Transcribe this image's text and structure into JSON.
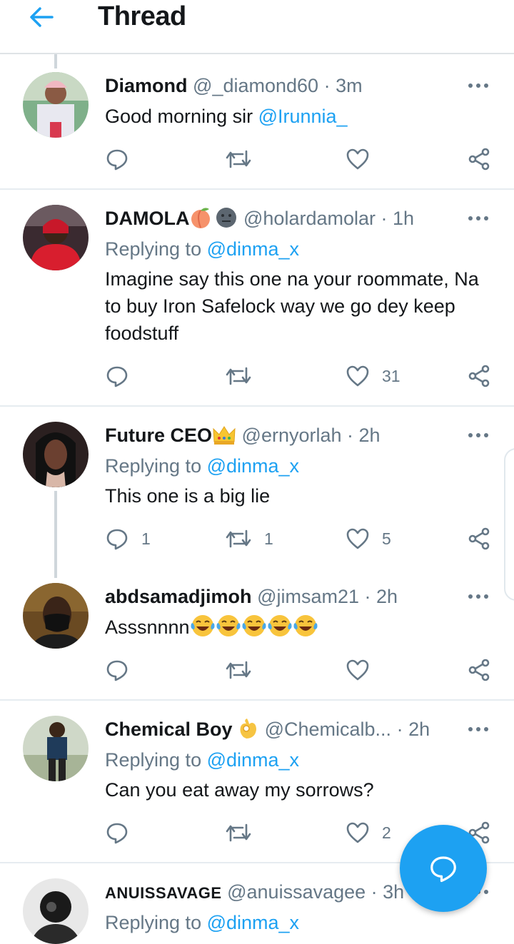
{
  "header": {
    "title": "Thread"
  },
  "tweets": [
    {
      "name": "Diamond",
      "handle": "@_diamond60",
      "time": "· 3m",
      "text_prefix": "Good morning sir ",
      "mention": "@Irunnia_",
      "reply_count": "",
      "retweet_count": "",
      "like_count": ""
    },
    {
      "name": "DAMOLA",
      "handle": "@holardamolar",
      "time": "· 1h",
      "replying_label": "Replying to ",
      "replying_to": "@dinma_x",
      "text": "Imagine say this one na your roommate, Na to buy Iron Safelock way we go dey keep foodstuff",
      "reply_count": "",
      "retweet_count": "",
      "like_count": "31"
    },
    {
      "name": "Future CEO",
      "handle": "@ernyorlah",
      "time": "· 2h",
      "replying_label": "Replying to ",
      "replying_to": "@dinma_x",
      "text": "This one is a big lie",
      "reply_count": "1",
      "retweet_count": "1",
      "like_count": "5"
    },
    {
      "name": "abdsamadjimoh",
      "handle": "@jimsam21",
      "time": "· 2h",
      "text": "Asssnnnn",
      "reply_count": "",
      "retweet_count": "",
      "like_count": ""
    },
    {
      "name": "Chemical Boy",
      "handle": "@Chemicalb...",
      "time": "· 2h",
      "replying_label": "Replying to ",
      "replying_to": "@dinma_x",
      "text": "Can you eat away my sorrows?",
      "reply_count": "",
      "retweet_count": "",
      "like_count": "2"
    },
    {
      "name": "ANUISSAVAGE",
      "handle": "@anuissavagee",
      "time": "· 3h",
      "replying_label": "Replying to ",
      "replying_to": "@dinma_x"
    }
  ],
  "icons": {
    "back": "arrow-left-icon",
    "more": "more-dots-icon",
    "reply": "reply-bubble-icon",
    "retweet": "retweet-icon",
    "like": "heart-icon",
    "share": "share-icon",
    "compose": "compose-reply-icon",
    "emoji_peach": "peach-emoji",
    "emoji_neutral": "neutral-face-emoji",
    "emoji_crown": "crown-emoji",
    "emoji_laugh": "tears-of-joy-emoji",
    "emoji_ok": "ok-hand-emoji"
  },
  "colors": {
    "accent": "#1da1f2",
    "text": "#14171a",
    "secondary": "#657786",
    "divider": "#e6ecf0"
  }
}
